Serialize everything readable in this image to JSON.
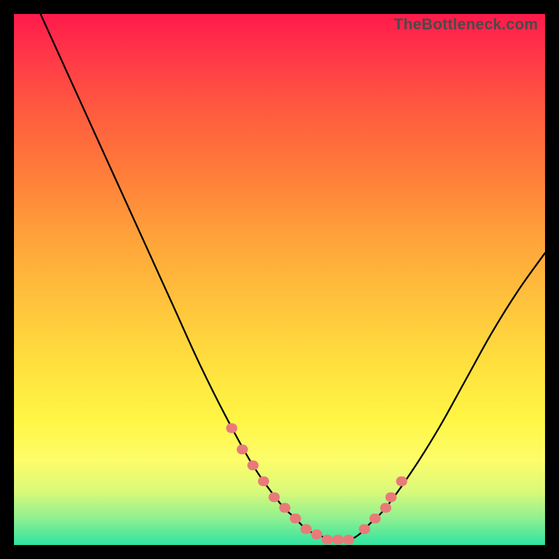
{
  "watermark": "TheBottleneck.com",
  "colors": {
    "curve_stroke": "#000000",
    "marker_fill": "#e97a7a",
    "marker_stroke": "#d96a6a"
  },
  "chart_data": {
    "type": "line",
    "title": "",
    "xlabel": "",
    "ylabel": "",
    "xlim": [
      0,
      100
    ],
    "ylim": [
      0,
      100
    ],
    "grid": false,
    "series": [
      {
        "name": "bottleneck-curve",
        "x": [
          5,
          10,
          15,
          20,
          25,
          30,
          35,
          40,
          45,
          50,
          53,
          55,
          57,
          60,
          63,
          65,
          67,
          70,
          75,
          80,
          85,
          90,
          95,
          100
        ],
        "values": [
          100,
          89,
          78,
          67,
          56,
          45,
          34,
          24,
          15,
          8,
          5,
          3,
          2,
          1,
          1,
          2,
          4,
          7,
          14,
          22,
          31,
          40,
          48,
          55
        ]
      }
    ],
    "markers": {
      "name": "highlighted-points",
      "x": [
        41,
        43,
        45,
        47,
        49,
        51,
        53,
        55,
        57,
        59,
        61,
        63,
        66,
        68,
        70,
        71,
        73
      ],
      "values": [
        22,
        18,
        15,
        12,
        9,
        7,
        5,
        3,
        2,
        1,
        1,
        1,
        3,
        5,
        7,
        9,
        12
      ]
    }
  }
}
